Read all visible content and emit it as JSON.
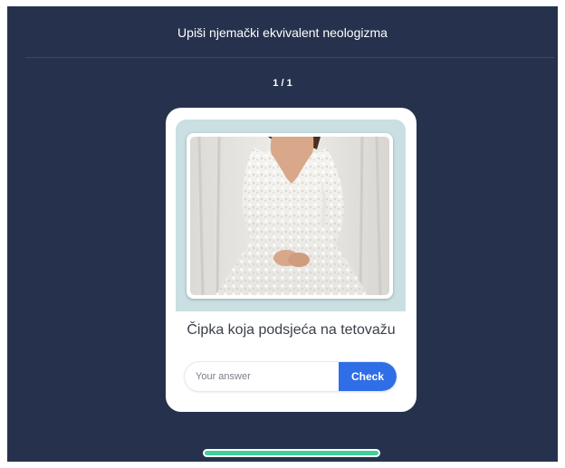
{
  "header": {
    "title": "Upiši njemački ekvivalent neologizma"
  },
  "quiz": {
    "counter": "1 / 1",
    "progress": 1.0,
    "card": {
      "image_alt": "wedding dress with lace sleeves",
      "prompt": "Čipka koja podsjeća na tetovažu",
      "answer": {
        "value": "",
        "placeholder": "Your answer"
      },
      "check_label": "Check"
    }
  },
  "colors": {
    "background": "#26324d",
    "accent": "#2f6ee6",
    "progress": "#3fcf9a",
    "image_frame": "#c9dfe1"
  }
}
